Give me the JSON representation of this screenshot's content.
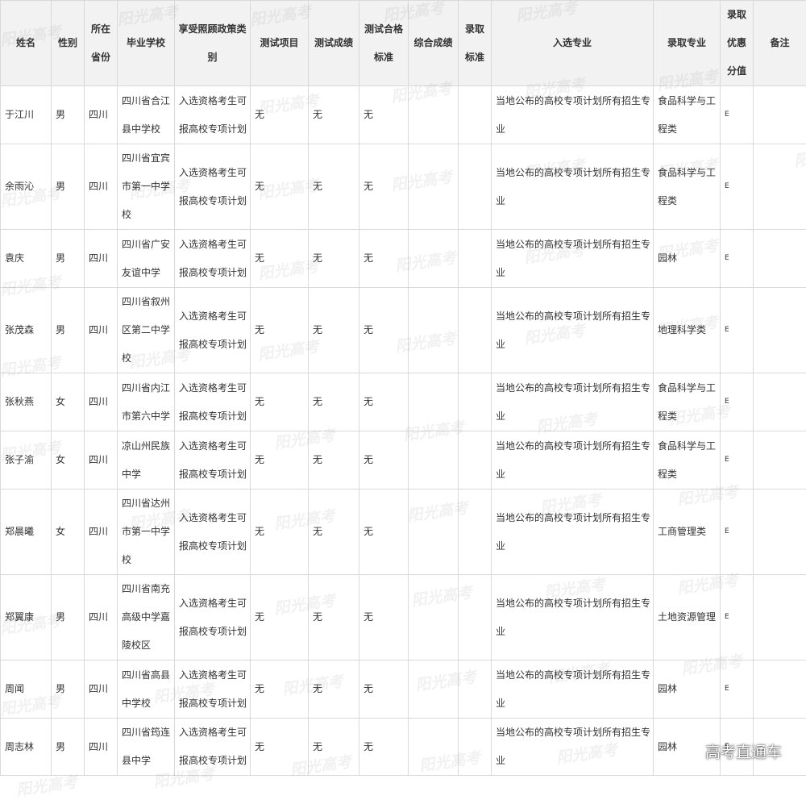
{
  "headers": [
    "姓名",
    "性别",
    "所在省份",
    "毕业学校",
    "享受照顾政策类别",
    "测试项目",
    "测试成绩",
    "测试合格标准",
    "综合成绩",
    "录取标准",
    "入选专业",
    "录取专业",
    "录取优惠分值",
    "备注"
  ],
  "rows": [
    [
      "于江川",
      "男",
      "四川",
      "四川省合江县中学校",
      "入选资格考生可报高校专项计划",
      "无",
      "无",
      "无",
      "",
      "",
      "当地公布的高校专项计划所有招生专业",
      "食品科学与工程类",
      "E",
      ""
    ],
    [
      "余雨沁",
      "男",
      "四川",
      "四川省宜宾市第一中学校",
      "入选资格考生可报高校专项计划",
      "无",
      "无",
      "无",
      "",
      "",
      "当地公布的高校专项计划所有招生专业",
      "食品科学与工程类",
      "E",
      ""
    ],
    [
      "袁庆",
      "男",
      "四川",
      "四川省广安友谊中学",
      "入选资格考生可报高校专项计划",
      "无",
      "无",
      "无",
      "",
      "",
      "当地公布的高校专项计划所有招生专业",
      "园林",
      "E",
      ""
    ],
    [
      "张茂森",
      "男",
      "四川",
      "四川省叙州区第二中学校",
      "入选资格考生可报高校专项计划",
      "无",
      "无",
      "无",
      "",
      "",
      "当地公布的高校专项计划所有招生专业",
      "地理科学类",
      "E",
      ""
    ],
    [
      "张秋燕",
      "女",
      "四川",
      "四川省内江市第六中学",
      "入选资格考生可报高校专项计划",
      "无",
      "无",
      "无",
      "",
      "",
      "当地公布的高校专项计划所有招生专业",
      "食品科学与工程类",
      "E",
      ""
    ],
    [
      "张子渝",
      "女",
      "四川",
      "凉山州民族中学",
      "入选资格考生可报高校专项计划",
      "无",
      "无",
      "无",
      "",
      "",
      "当地公布的高校专项计划所有招生专业",
      "食品科学与工程类",
      "E",
      ""
    ],
    [
      "郑晨曦",
      "女",
      "四川",
      "四川省达州市第一中学校",
      "入选资格考生可报高校专项计划",
      "无",
      "无",
      "无",
      "",
      "",
      "当地公布的高校专项计划所有招生专业",
      "工商管理类",
      "E",
      ""
    ],
    [
      "郑翼康",
      "男",
      "四川",
      "四川省南充高级中学嘉陵校区",
      "入选资格考生可报高校专项计划",
      "无",
      "无",
      "无",
      "",
      "",
      "当地公布的高校专项计划所有招生专业",
      "土地资源管理",
      "E",
      ""
    ],
    [
      "周闻",
      "男",
      "四川",
      "四川省高县中学校",
      "入选资格考生可报高校专项计划",
      "无",
      "无",
      "无",
      "",
      "",
      "当地公布的高校专项计划所有招生专业",
      "园林",
      "E",
      ""
    ],
    [
      "周志林",
      "男",
      "四川",
      "四川省筠连县中学",
      "入选资格考生可报高校专项计划",
      "无",
      "无",
      "无",
      "",
      "",
      "当地公布的高校专项计划所有招生专业",
      "园林",
      "E",
      ""
    ]
  ],
  "watermark_text": "阳光高考",
  "brand_text": "高考直通车"
}
